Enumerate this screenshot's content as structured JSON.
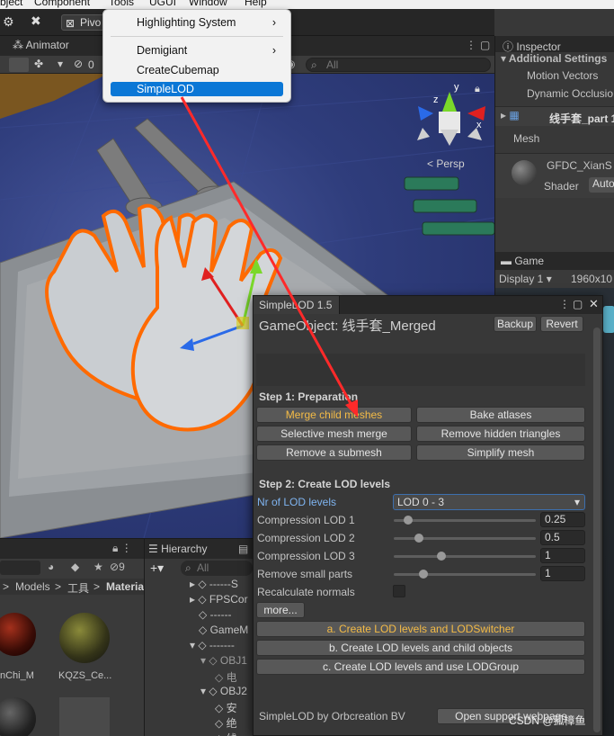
{
  "menubar": {
    "items": [
      "bject",
      "Component",
      "Tools",
      "UGUI",
      "Window",
      "Help"
    ]
  },
  "toolbar": {
    "pivot_label": "Pivo"
  },
  "scene_tabs": {
    "animator": "Animator"
  },
  "scene_ctrl": {
    "counter": "0",
    "search_placeholder": "All"
  },
  "scene_view": {
    "persp_label": "< Persp",
    "axis_y": "y",
    "axis_z": "z",
    "axis_x": "x"
  },
  "tools_menu": {
    "items": [
      {
        "label": "Highlighting System",
        "has_submenu": true
      },
      {
        "label": "Demigiant",
        "has_submenu": true
      },
      {
        "label": "CreateCubemap",
        "has_submenu": false
      },
      {
        "label": "SimpleLOD",
        "has_submenu": false,
        "selected": true
      }
    ]
  },
  "inspector": {
    "tab": "Inspector",
    "additional_settings": "Additional Settings",
    "motion_vectors": "Motion Vectors",
    "dynamic_occlusion": "Dynamic Occlusio",
    "object_name": "线手套_part 1",
    "mesh_label": "Mesh",
    "material_name": "GFDC_XianS",
    "shader_label": "Shader",
    "shader_value": "Auto"
  },
  "game": {
    "tab": "Game",
    "display": "Display 1",
    "resolution": "1960x10"
  },
  "project": {
    "breadcrumb": [
      "Models",
      "工具",
      "Materia"
    ],
    "asset_count": "9",
    "assets": [
      {
        "name": "nChi_M",
        "color": "#3a0c06"
      },
      {
        "name": "KQZS_Ce...",
        "color": "#6a6a1c"
      }
    ]
  },
  "hierarchy": {
    "tab": "Hierarchy",
    "search_placeholder": "All",
    "rows": [
      "------S",
      "FPSCor",
      "------",
      "GameM",
      "-------",
      "OBJ1",
      "电",
      "OBJ2",
      "安",
      "绝",
      "线"
    ]
  },
  "lod_window": {
    "tab": "SimpleLOD 1.5",
    "game_object": "GameObject: 线手套_Merged",
    "backup": "Backup",
    "revert": "Revert",
    "step1": "Step 1: Preparation",
    "merge_child_meshes": "Merge child meshes",
    "bake_atlases": "Bake atlases",
    "selective_mesh_merge": "Selective mesh merge",
    "remove_hidden_triangles": "Remove hidden triangles",
    "remove_submesh": "Remove a submesh",
    "simplify_mesh": "Simplify mesh",
    "step2": "Step 2: Create LOD levels",
    "nr_lod_levels": "Nr of LOD levels",
    "nr_lod_value": "LOD 0 - 3",
    "compression_lod1": "Compression LOD 1",
    "compression_lod1_value": "0.25",
    "compression_lod2": "Compression LOD 2",
    "compression_lod2_value": "0.5",
    "compression_lod3": "Compression LOD 3",
    "compression_lod3_value": "1",
    "remove_small_parts": "Remove small parts",
    "remove_small_parts_value": "1",
    "recalculate_normals": "Recalculate normals",
    "more": "more...",
    "btn_a": "a. Create LOD levels and LODSwitcher",
    "btn_b": "b. Create LOD levels and child objects",
    "btn_c": "c. Create LOD levels and use LODGroup",
    "footer": "SimpleLOD by Orbcreation BV",
    "support": "Open support webpage"
  },
  "watermark": "CSDN @孤樟鱼",
  "colors": {
    "accent_orange": "#f4bb46",
    "selection_blue": "#0b77d6",
    "arrow_red": "#ff2a2a",
    "outline_orange": "#ff6a00"
  }
}
